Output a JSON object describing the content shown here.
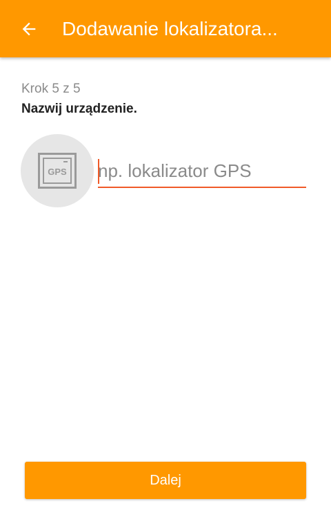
{
  "app_bar": {
    "title": "Dodawanie lokalizatora...",
    "back_icon": "arrow-left-icon",
    "background_color": "#ff9800"
  },
  "step": {
    "label": "Krok 5 z 5",
    "instruction": "Nazwij urządzenie."
  },
  "device": {
    "icon": "gps-device-icon",
    "icon_text": "GPS"
  },
  "name_input": {
    "value": "",
    "placeholder": "np. lokalizator GPS",
    "accent_color": "#f05a28"
  },
  "footer": {
    "next_label": "Dalej"
  }
}
